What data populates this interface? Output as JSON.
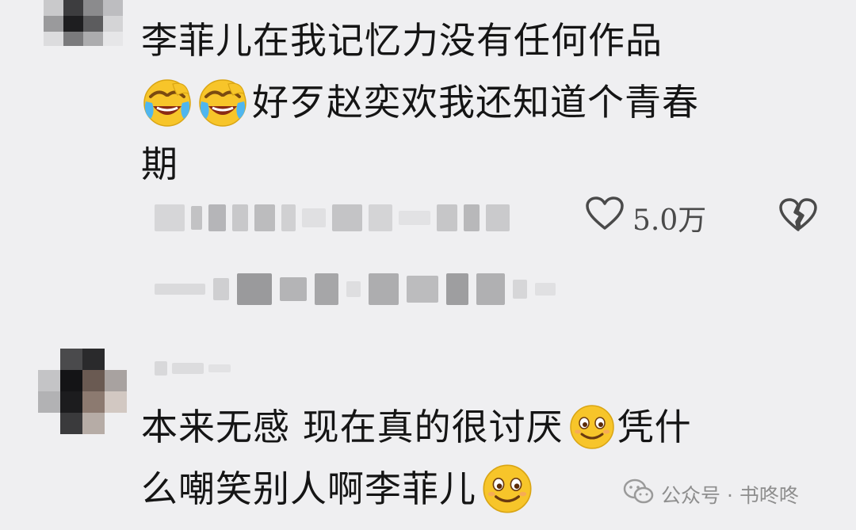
{
  "comments": [
    {
      "line1": "李菲儿在我记忆力没有任何作品",
      "line2": "好歹赵奕欢我还知道个青春",
      "line3": "期",
      "like_count": "5.0万"
    },
    {
      "line1_a": "本来无感 现在真的很讨厌",
      "line1_b": "凭什",
      "line2": "么嘲笑别人啊李菲儿"
    }
  ],
  "icons": {
    "laugh_cry": "laugh-cry-emoji",
    "smile": "smile-emoji",
    "like": "heart-outline-icon",
    "dislike": "broken-heart-icon",
    "wechat": "wechat-icon"
  },
  "watermark": {
    "text": "公众号 · 书咚咚"
  },
  "colors": {
    "background": "#efeff1",
    "text": "#151515",
    "emoji_yellow": "#f7c52a",
    "watermark": "#8e8e8e"
  }
}
